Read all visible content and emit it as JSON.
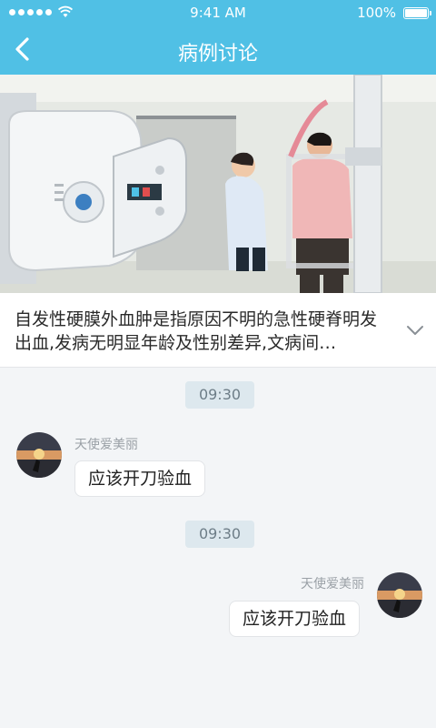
{
  "status_bar": {
    "time": "9:41 AM",
    "battery": "100%",
    "signal_icon": "signal-dots-icon",
    "wifi_icon": "wifi-icon",
    "battery_icon": "battery-icon"
  },
  "header": {
    "title": "病例讨论",
    "back_icon": "back-arrow-icon"
  },
  "hero": {
    "image": "medical-xray-photo"
  },
  "case": {
    "summary": "自发性硬膜外血肿是指原因不明的急性硬脊明发出血,发病无明显年龄及性别差异,文病间…",
    "expand_icon": "chevron-down-icon"
  },
  "messages": [
    {
      "time": "09:30",
      "sender": "天使爱美丽",
      "text": "应该开刀验血",
      "side": "left",
      "avatar": "sunset-avatar"
    },
    {
      "time": "09:30",
      "sender": "天使爱美丽",
      "text": "应该开刀验血",
      "side": "right",
      "avatar": "sunset-avatar"
    }
  ],
  "colors": {
    "primary": "#50c0e5",
    "background": "#f3f5f7",
    "bubble": "#ffffff",
    "time_pill": "#dde8ee"
  }
}
